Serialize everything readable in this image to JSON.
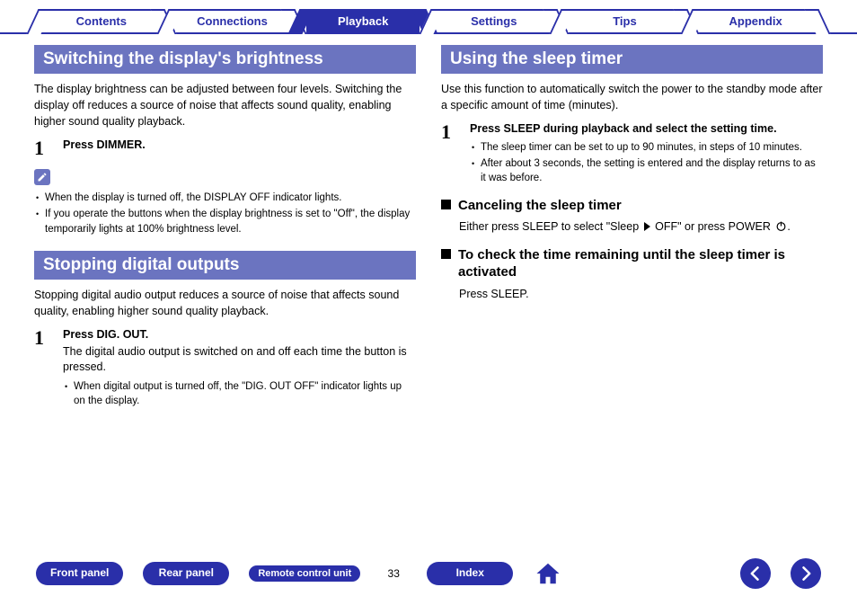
{
  "tabs": {
    "contents": "Contents",
    "connections": "Connections",
    "playback": "Playback",
    "settings": "Settings",
    "tips": "Tips",
    "appendix": "Appendix"
  },
  "left": {
    "brightness": {
      "title": "Switching the display's brightness",
      "intro": "The display brightness can be adjusted between four levels. Switching the display off reduces a source of noise that affects sound quality, enabling higher sound quality playback.",
      "step1_num": "1",
      "step1_heading": "Press DIMMER.",
      "notes": [
        "When the display is turned off, the DISPLAY OFF indicator lights.",
        "If you operate the buttons when the display brightness is set to \"Off\", the display temporarily lights at 100% brightness level."
      ]
    },
    "digital": {
      "title": "Stopping digital outputs",
      "intro": "Stopping digital audio output reduces a source of noise that affects sound quality, enabling higher sound quality playback.",
      "step1_num": "1",
      "step1_heading": "Press DIG. OUT.",
      "step1_body": "The digital audio output is switched on and off each time the button is pressed.",
      "step1_bullet": "When digital output is turned off, the \"DIG. OUT OFF\" indicator lights up on the display."
    }
  },
  "right": {
    "sleep": {
      "title": "Using the sleep timer",
      "intro": "Use this function to automatically switch the power to the standby mode after a specific amount of time (minutes).",
      "step1_num": "1",
      "step1_heading": "Press SLEEP during playback and select the setting time.",
      "step1_bullets": [
        "The sleep timer can be set to up to 90 minutes, in steps of 10 minutes.",
        "After about 3 seconds, the setting is entered and the display returns to as it was before."
      ],
      "cancel_heading": "Canceling the sleep timer",
      "cancel_body_pre": "Either press SLEEP to select \"Sleep ",
      "cancel_body_post": " OFF\" or press POWER ",
      "cancel_body_end": ".",
      "check_heading": "To check the time remaining until the sleep timer is activated",
      "check_body": "Press SLEEP."
    }
  },
  "footer": {
    "front_panel": "Front panel",
    "rear_panel": "Rear panel",
    "remote": "Remote control unit",
    "page": "33",
    "index": "Index"
  }
}
